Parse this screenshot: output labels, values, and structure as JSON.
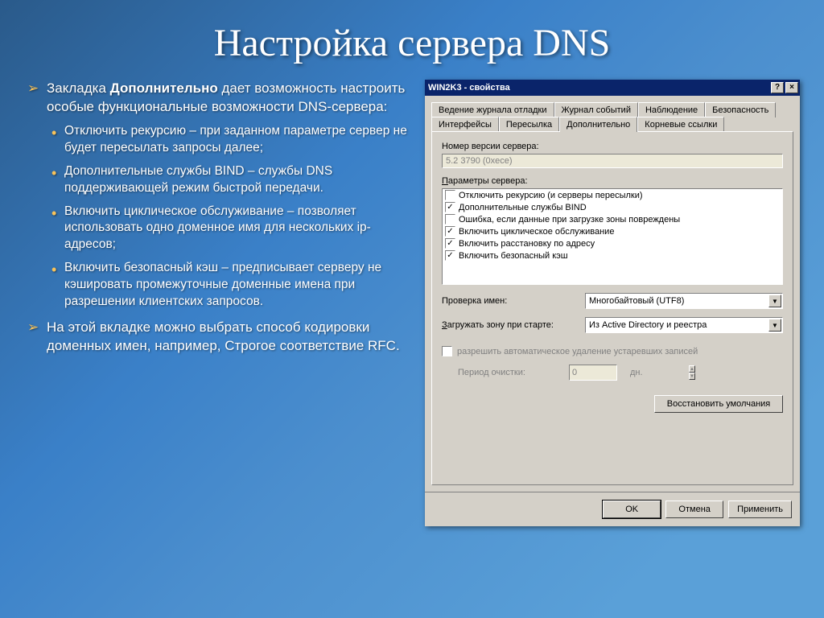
{
  "slide": {
    "title": "Настройка сервера DNS",
    "p1_prefix": "Закладка ",
    "p1_bold": "Дополнительно",
    "p1_suffix": " дает возможность настроить особые функциональные возможности DNS-сервера:",
    "sub": [
      "Отключить рекурсию – при заданном параметре сервер не будет пересылать запросы далее;",
      "Дополнительные службы BIND – службы DNS поддерживающей режим быстрой передачи.",
      "Включить циклическое обслуживание – позволяет использовать одно доменное имя для нескольких ip-адресов;",
      "Включить безопасный кэш – предписывает серверу не кэшировать промежуточные доменные имена при разрешении клиентских запросов."
    ],
    "p2": "На этой вкладке можно выбрать способ кодировки доменных имен, например, Строгое соответствие RFC."
  },
  "dialog": {
    "title": "WIN2K3 - свойства",
    "tabs_row1": [
      "Ведение журнала отладки",
      "Журнал событий",
      "Наблюдение",
      "Безопасность"
    ],
    "tabs_row2": [
      "Интерфейсы",
      "Пересылка",
      "Дополнительно",
      "Корневые ссылки"
    ],
    "active_tab": "Дополнительно",
    "version_label": "Номер версии сервера:",
    "version_value": "5.2 3790 (0xece)",
    "params_label": "Параметры сервера:",
    "options": [
      {
        "checked": false,
        "label": "Отключить рекурсию (и серверы пересылки)"
      },
      {
        "checked": true,
        "label": "Дополнительные службы BIND"
      },
      {
        "checked": false,
        "label": "Ошибка, если данные при загрузке зоны повреждены"
      },
      {
        "checked": true,
        "label": "Включить циклическое обслуживание"
      },
      {
        "checked": true,
        "label": "Включить расстановку по адресу"
      },
      {
        "checked": true,
        "label": "Включить безопасный кэш"
      }
    ],
    "name_check_label": "Проверка имен:",
    "name_check_value": "Многобайтовый (UTF8)",
    "zone_load_label": "Загружать зону при старте:",
    "zone_load_value": "Из Active Directory и реестра",
    "scavenge_label": "разрешить автоматическое удаление устаревших записей",
    "cleanup_period_label": "Период очистки:",
    "cleanup_period_value": "0",
    "cleanup_period_unit": "дн.",
    "restore_button": "Восстановить умолчания",
    "ok": "OK",
    "cancel": "Отмена",
    "apply": "Применить"
  }
}
